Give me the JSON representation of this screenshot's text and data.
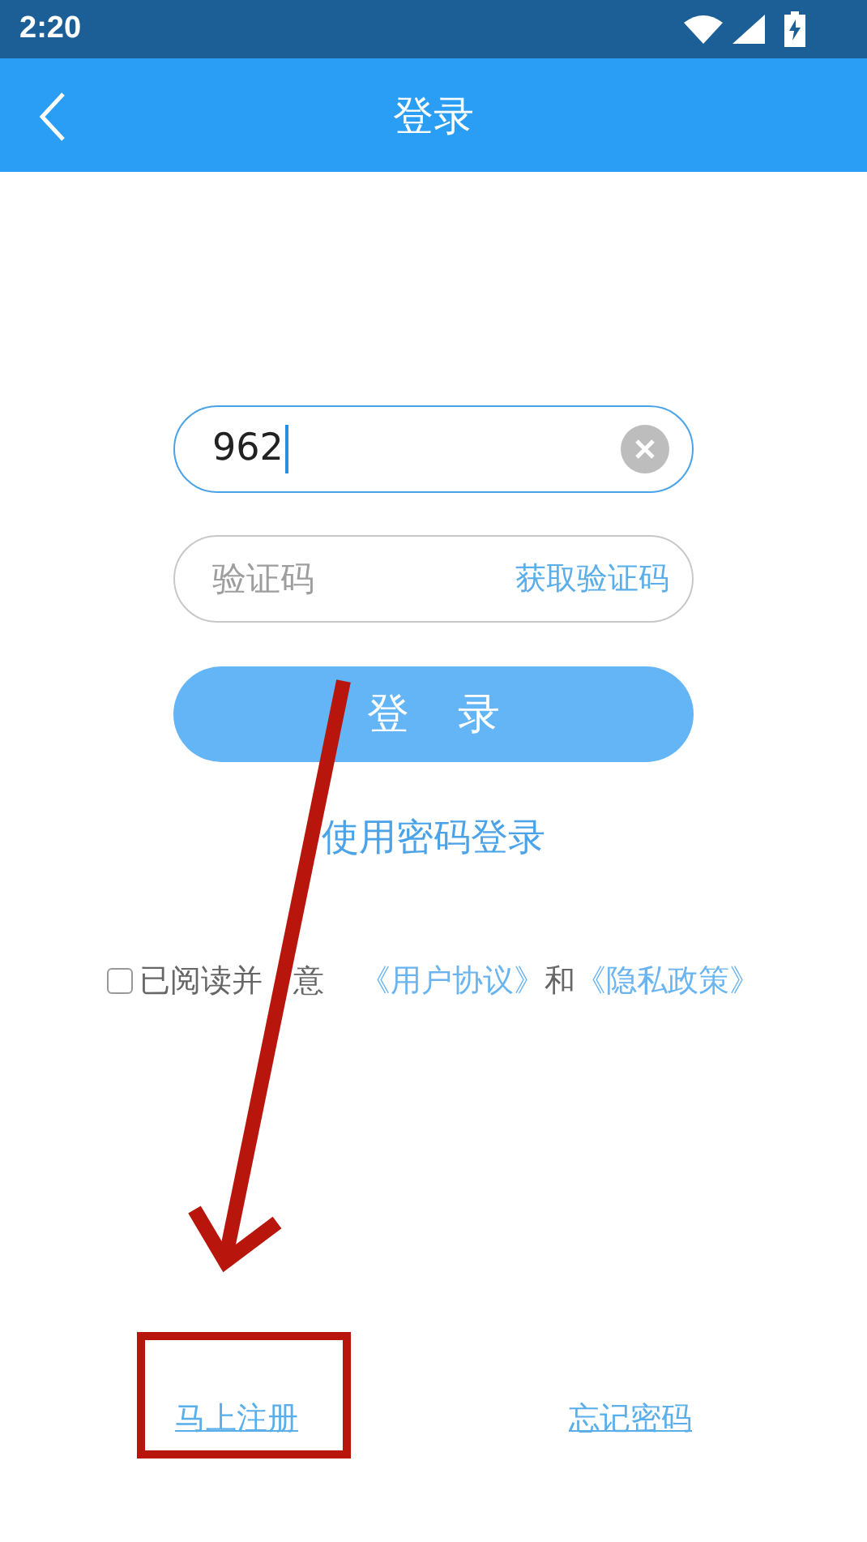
{
  "status_bar": {
    "time": "2:20"
  },
  "header": {
    "title": "登录"
  },
  "phone_field": {
    "value": "962"
  },
  "code_field": {
    "placeholder": "验证码",
    "action": "获取验证码"
  },
  "login_button": "登 录",
  "password_login_link": "使用密码登录",
  "agreement": {
    "checked": false,
    "text": "已阅读并",
    "text_after_arrow": "意",
    "links": [
      "《用户协议》",
      "《隐私政策》"
    ],
    "joiner": "和"
  },
  "footer_links": [
    "马上注册",
    "忘记密码"
  ],
  "annotations": {
    "arrow": true,
    "highlight_box": true
  }
}
